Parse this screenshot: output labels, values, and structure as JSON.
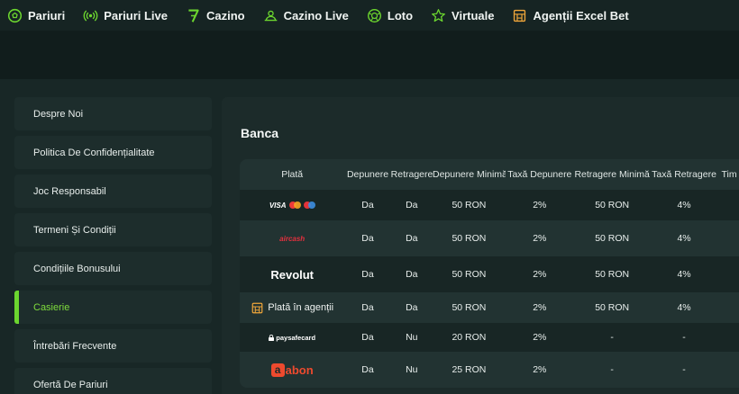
{
  "nav": {
    "items": [
      {
        "label": "Pariuri",
        "icon": "soccer-ball-icon"
      },
      {
        "label": "Pariuri Live",
        "icon": "live-signal-icon"
      },
      {
        "label": "Cazino",
        "icon": "seven-icon"
      },
      {
        "label": "Cazino Live",
        "icon": "dealer-icon"
      },
      {
        "label": "Loto",
        "icon": "lottery-ball-icon"
      },
      {
        "label": "Virtuale",
        "icon": "star-icon"
      },
      {
        "label": "Agenții Excel Bet",
        "icon": "store-icon"
      }
    ],
    "accent": "#6cd62f",
    "agency_icon_color": "#f0a63a"
  },
  "sidebar": {
    "items": [
      {
        "label": "Despre Noi",
        "active": false
      },
      {
        "label": "Politica De Confidențialitate",
        "active": false
      },
      {
        "label": "Joc Responsabil",
        "active": false
      },
      {
        "label": "Termeni Și Condiții",
        "active": false
      },
      {
        "label": "Condițiile Bonusului",
        "active": false
      },
      {
        "label": "Casierie",
        "active": true
      },
      {
        "label": "Întrebări Frecvente",
        "active": false
      },
      {
        "label": "Ofertă De Pariuri",
        "active": false
      }
    ]
  },
  "main": {
    "title": "Banca",
    "table": {
      "headers": [
        "Plată",
        "Depunere",
        "Retragere",
        "Depunere Minimă",
        "Taxă Depunere",
        "Retragere Minimă",
        "Taxă Retragere",
        "Tim"
      ],
      "rows": [
        {
          "method": "VISA",
          "method_logo": "visa-mastercard-maestro-logo",
          "deposit": "Da",
          "withdraw": "Da",
          "min_deposit": "50 RON",
          "deposit_fee": "2%",
          "min_withdraw": "50 RON",
          "withdraw_fee": "4%"
        },
        {
          "method": "aircash",
          "method_logo": "aircash-logo",
          "deposit": "Da",
          "withdraw": "Da",
          "min_deposit": "50 RON",
          "deposit_fee": "2%",
          "min_withdraw": "50 RON",
          "withdraw_fee": "4%"
        },
        {
          "method": "Revolut",
          "method_logo": "revolut-logo",
          "deposit": "Da",
          "withdraw": "Da",
          "min_deposit": "50 RON",
          "deposit_fee": "2%",
          "min_withdraw": "50 RON",
          "withdraw_fee": "4%"
        },
        {
          "method": "Plată în agenții",
          "method_logo": "store-icon",
          "deposit": "Da",
          "withdraw": "Da",
          "min_deposit": "50 RON",
          "deposit_fee": "2%",
          "min_withdraw": "50 RON",
          "withdraw_fee": "4%"
        },
        {
          "method": "paysafecard",
          "method_logo": "paysafecard-logo",
          "deposit": "Da",
          "withdraw": "Nu",
          "min_deposit": "20 RON",
          "deposit_fee": "2%",
          "min_withdraw": "-",
          "withdraw_fee": "-"
        },
        {
          "method": "abon",
          "method_logo": "abon-logo",
          "deposit": "Da",
          "withdraw": "Nu",
          "min_deposit": "25 RON",
          "deposit_fee": "2%",
          "min_withdraw": "-",
          "withdraw_fee": "-"
        }
      ]
    }
  }
}
